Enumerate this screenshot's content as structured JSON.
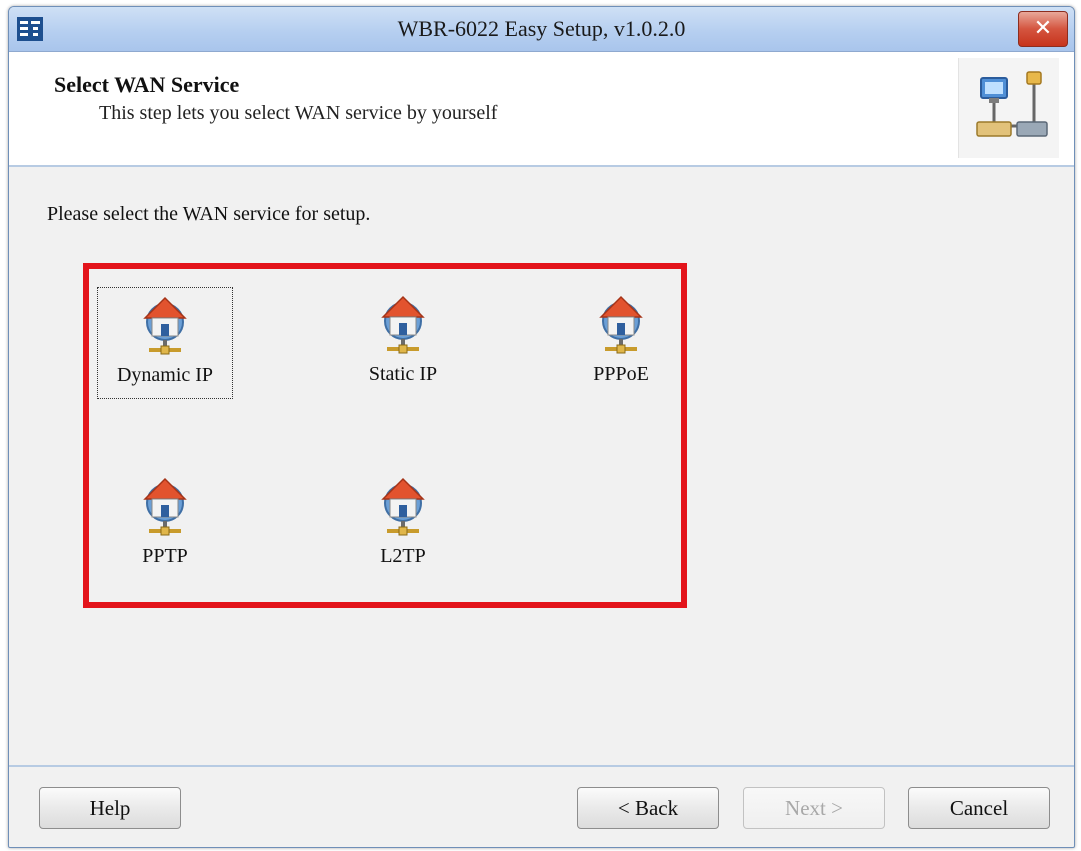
{
  "window": {
    "title": "WBR-6022 Easy Setup, v1.0.2.0",
    "close_glyph": "✕"
  },
  "header": {
    "title": "Select WAN Service",
    "subtitle": "This step lets you select WAN service by yourself"
  },
  "instruction": "Please select the WAN service for setup.",
  "services": [
    {
      "label": "Dynamic IP",
      "icon": "network-house-icon",
      "focused": true
    },
    {
      "label": "Static IP",
      "icon": "network-house-icon",
      "focused": false
    },
    {
      "label": "PPPoE",
      "icon": "network-house-icon",
      "focused": false
    },
    {
      "label": "PPTP",
      "icon": "network-house-icon",
      "focused": false
    },
    {
      "label": "L2TP",
      "icon": "network-house-icon",
      "focused": false
    }
  ],
  "buttons": {
    "help": "Help",
    "back": "< Back",
    "next": "Next >",
    "cancel": "Cancel"
  },
  "colors": {
    "highlight_border": "#e3141b",
    "titlebar": "#b6cff0",
    "close_button": "#c7341c"
  }
}
